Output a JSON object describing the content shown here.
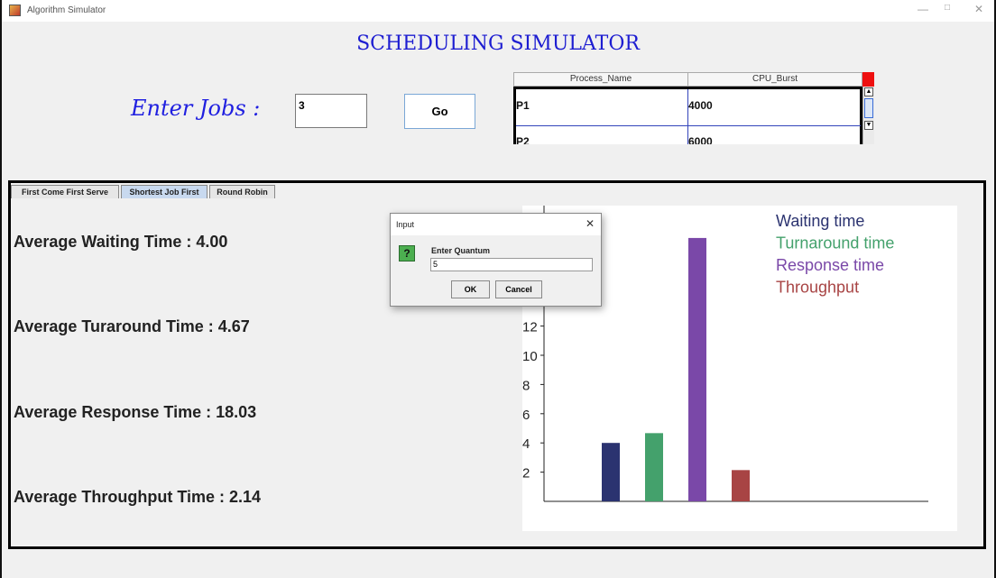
{
  "window": {
    "title": "Algorithm Simulator",
    "controls": [
      "—",
      "□",
      "✕"
    ]
  },
  "header": {
    "title": "SCHEDULING SIMULATOR"
  },
  "jobs": {
    "label": "Enter Jobs :",
    "value": "3",
    "go_label": "Go"
  },
  "process_table": {
    "columns": [
      "Process_Name",
      "CPU_Burst"
    ],
    "rows": [
      {
        "name": "P1",
        "burst": "4000"
      },
      {
        "name": "P2",
        "burst": "6000"
      }
    ]
  },
  "tabs": [
    {
      "label": "First Come First Serve",
      "active": false
    },
    {
      "label": "Shortest Job First",
      "active": true
    },
    {
      "label": "Round Robin",
      "active": false
    }
  ],
  "stats": [
    "Average Waiting Time : 4.00",
    "Average Turaround Time : 4.67",
    "Average Response Time : 18.03",
    "Average Throughput Time : 2.14"
  ],
  "chart_data": {
    "type": "bar",
    "categories": [
      "Waiting time",
      "Turnaround time",
      "Response time",
      "Throughput"
    ],
    "values": [
      4.0,
      4.67,
      18.03,
      2.14
    ],
    "colors": [
      "#2b3370",
      "#44a16c",
      "#7a48a8",
      "#a84444"
    ],
    "yticks": [
      2,
      4,
      6,
      8,
      10,
      12
    ],
    "legend_position": "top-right",
    "title": "",
    "xlabel": "",
    "ylabel": ""
  },
  "dialog": {
    "title": "Input",
    "prompt": "Enter Quantum",
    "value": "5",
    "ok_label": "OK",
    "cancel_label": "Cancel",
    "icon": "question-icon"
  }
}
